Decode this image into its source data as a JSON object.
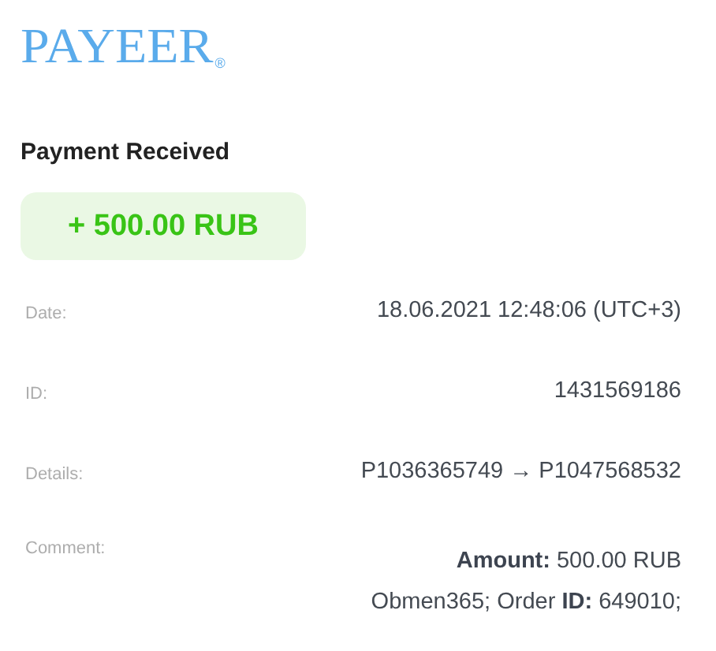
{
  "logo": {
    "text": "PAYEER",
    "mark": "®"
  },
  "title": "Payment Received",
  "amount": "+ 500.00 RUB",
  "fields": [
    {
      "label": "Date:",
      "lines": [
        "18.06.2021 12:48:06 (UTC+3)"
      ]
    },
    {
      "label": "ID:",
      "lines": [
        "1431569186"
      ]
    },
    {
      "label": "Details:",
      "lines": [
        "P1036365749 → P1047568532"
      ]
    },
    {
      "label": "Comment:",
      "lines": [
        "**Amount:** 500.00 RUB",
        "Obmen365; Order **ID:** 649010;"
      ]
    }
  ]
}
